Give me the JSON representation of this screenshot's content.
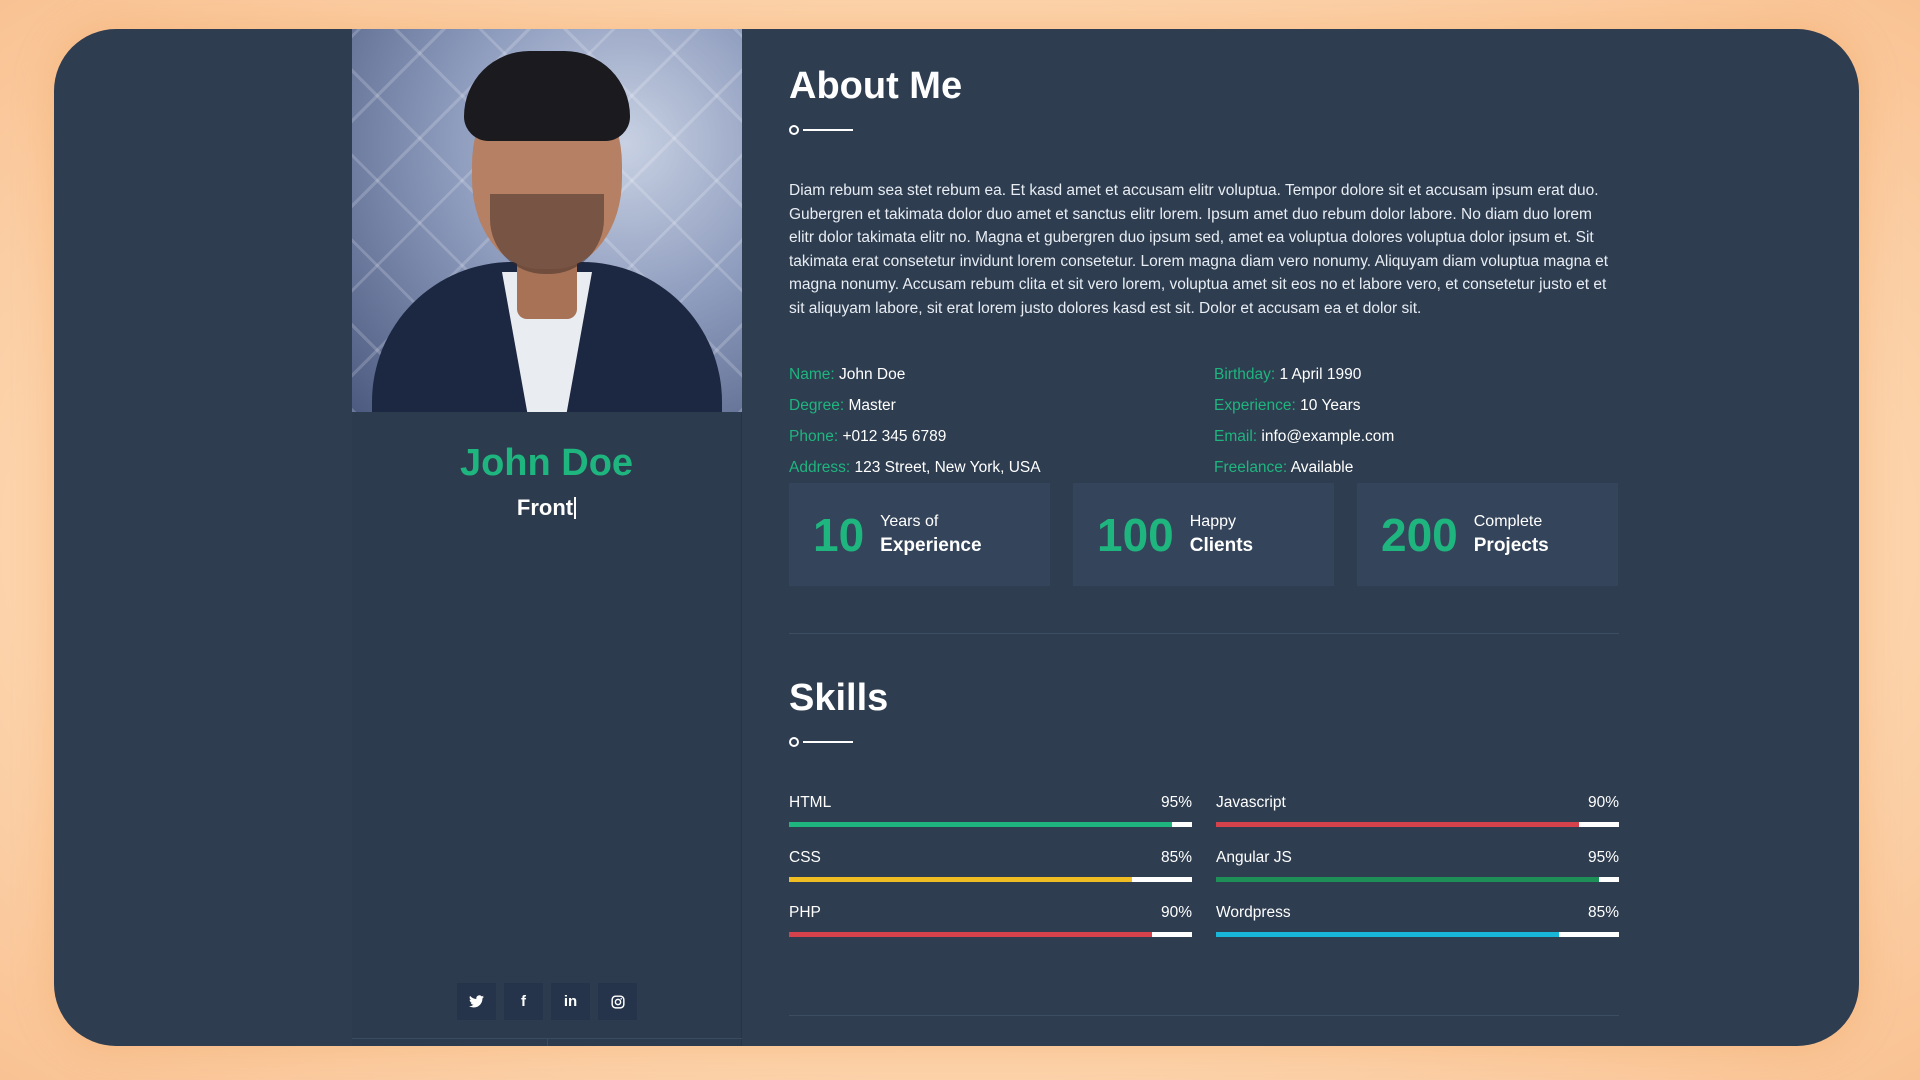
{
  "profile": {
    "name": "John Doe",
    "role_typed": "Front"
  },
  "social": {
    "items": [
      {
        "icon": "twitter-icon",
        "glyph": "🐦"
      },
      {
        "icon": "facebook-icon",
        "glyph": "f"
      },
      {
        "icon": "linkedin-icon",
        "glyph": "in"
      },
      {
        "icon": "instagram-icon",
        "glyph": "◎"
      }
    ]
  },
  "about": {
    "title": "About Me",
    "text": "Diam rebum sea stet rebum ea. Et kasd amet et accusam elitr voluptua. Tempor dolore sit et accusam ipsum erat duo. Gubergren et takimata dolor duo amet et sanctus elitr lorem. Ipsum amet duo rebum dolor labore. No diam duo lorem elitr dolor takimata elitr no. Magna et gubergren duo ipsum sed, amet ea voluptua dolores voluptua dolor ipsum et. Sit takimata erat consetetur invidunt lorem consetetur. Lorem magna diam vero nonumy. Aliquyam diam voluptua magna et magna nonumy. Accusam rebum clita et sit vero lorem, voluptua amet sit eos no et labore vero, et consetetur justo et et sit aliquyam labore, sit erat lorem justo dolores kasd est sit. Dolor et accusam ea et dolor sit.",
    "info": [
      {
        "key": "Name:",
        "value": "John Doe"
      },
      {
        "key": "Birthday:",
        "value": "1 April 1990"
      },
      {
        "key": "Degree:",
        "value": "Master"
      },
      {
        "key": "Experience:",
        "value": "10 Years"
      },
      {
        "key": "Phone:",
        "value": "+012 345 6789"
      },
      {
        "key": "Email:",
        "value": "info@example.com"
      },
      {
        "key": "Address:",
        "value": "123 Street, New York, USA"
      },
      {
        "key": "Freelance:",
        "value": "Available"
      }
    ]
  },
  "stats": [
    {
      "number": "10",
      "line1": "Years of",
      "line2": "Experience"
    },
    {
      "number": "100",
      "line1": "Happy",
      "line2": "Clients"
    },
    {
      "number": "200",
      "line1": "Complete",
      "line2": "Projects"
    }
  ],
  "skills": {
    "title": "Skills",
    "items": [
      {
        "name": "HTML",
        "percent_label": "95%",
        "level": 0.95,
        "color": "#1fb57f"
      },
      {
        "name": "Javascript",
        "percent_label": "90%",
        "level": 0.9,
        "color": "#d6424b"
      },
      {
        "name": "CSS",
        "percent_label": "85%",
        "level": 0.85,
        "color": "#f0bd22"
      },
      {
        "name": "Angular JS",
        "percent_label": "95%",
        "level": 0.95,
        "color": "#1e8f56"
      },
      {
        "name": "PHP",
        "percent_label": "90%",
        "level": 0.9,
        "color": "#d6424b"
      },
      {
        "name": "Wordpress",
        "percent_label": "85%",
        "level": 0.85,
        "color": "#18b6d8"
      }
    ]
  },
  "colors": {
    "accent": "#1fb57f",
    "background": "#2e3d50"
  }
}
